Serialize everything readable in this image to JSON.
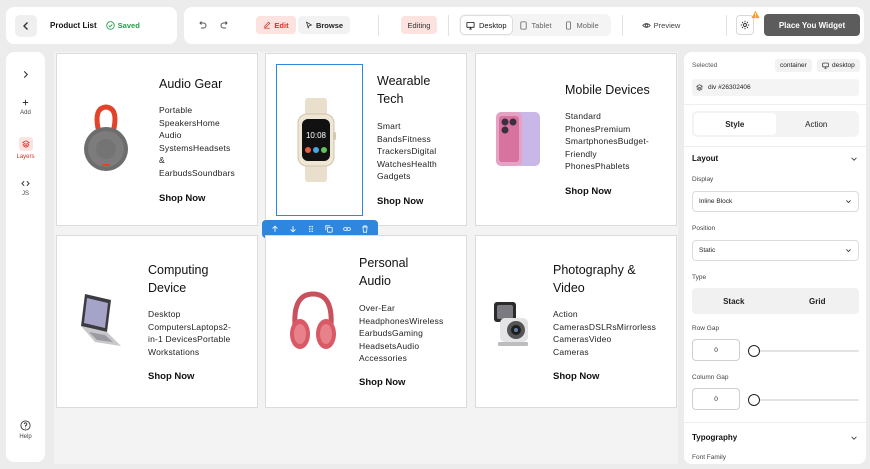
{
  "header": {
    "page_title": "Product List",
    "saved_label": "Saved",
    "edit_label": "Edit",
    "browse_label": "Browse",
    "editing_label": "Editing",
    "devices": [
      "Desktop",
      "Tablet",
      "Mobile"
    ],
    "active_device": "Desktop",
    "preview_label": "Preview",
    "place_widget_label": "Place You Widget"
  },
  "rail": {
    "add_label": "Add",
    "layers_label": "Layers",
    "js_label": "JS",
    "help_label": "Help"
  },
  "cards": [
    {
      "title": "Audio Gear",
      "desc": [
        "Portable",
        "SpeakersHome",
        "Audio",
        "SystemsHeadsets",
        "&",
        "EarbudsSoundbars"
      ],
      "cta": "Shop Now",
      "icon": "speaker-icon"
    },
    {
      "title": "Wearable Tech",
      "title_lines": [
        "Wearable",
        "Tech"
      ],
      "desc": [
        "Smart",
        "BandsFitness",
        "TrackersDigital",
        "WatchesHealth",
        "Gadgets"
      ],
      "cta": "Shop Now",
      "icon": "smartwatch-icon",
      "watch_time": "10:08"
    },
    {
      "title": "Mobile Devices",
      "desc": [
        "Standard",
        "PhonesPremium",
        "SmartphonesBudget-",
        "Friendly",
        "PhonesPhablets"
      ],
      "cta": "Shop Now",
      "icon": "smartphone-icon"
    },
    {
      "title": "Computing Device",
      "title_lines": [
        "Computing",
        "Device"
      ],
      "desc": [
        "Desktop",
        "ComputersLaptops2-",
        "in-1 DevicesPortable",
        "Workstations"
      ],
      "cta": "Shop Now",
      "icon": "laptop-icon"
    },
    {
      "title": "Personal Audio",
      "title_lines": [
        "Personal",
        "Audio"
      ],
      "desc": [
        "Over-Ear",
        "HeadphonesWireless",
        "EarbudsGaming",
        "HeadsetsAudio",
        "Accessories"
      ],
      "cta": "Shop Now",
      "icon": "headphones-icon"
    },
    {
      "title": "Photography & Video",
      "title_lines": [
        "Photography &",
        "Video"
      ],
      "desc": [
        "Action",
        "CamerasDSLRsMirrorless",
        "CamerasVideo",
        "Cameras"
      ],
      "cta": "Shop Now",
      "icon": "camera-icon"
    }
  ],
  "panel": {
    "selected_label": "Selected",
    "chip_container": "container",
    "chip_device": "desktop",
    "element_id": "div #26302406",
    "tabs": [
      "Style",
      "Action"
    ],
    "active_tab": "Style",
    "layout_title": "Layout",
    "display_label": "Display",
    "display_value": "Inline Block",
    "position_label": "Position",
    "position_value": "Static",
    "type_label": "Type",
    "type_options": [
      "Stack",
      "Grid"
    ],
    "row_gap_label": "Row Gap",
    "row_gap_value": "0",
    "column_gap_label": "Column Gap",
    "column_gap_value": "0",
    "typography_title": "Typography",
    "font_family_label": "Font Family"
  },
  "colors": {
    "accent_red": "#d6332a",
    "saved_green": "#22a04b",
    "selection_blue": "#2f86de",
    "place_button_bg": "#5c5c5c"
  }
}
